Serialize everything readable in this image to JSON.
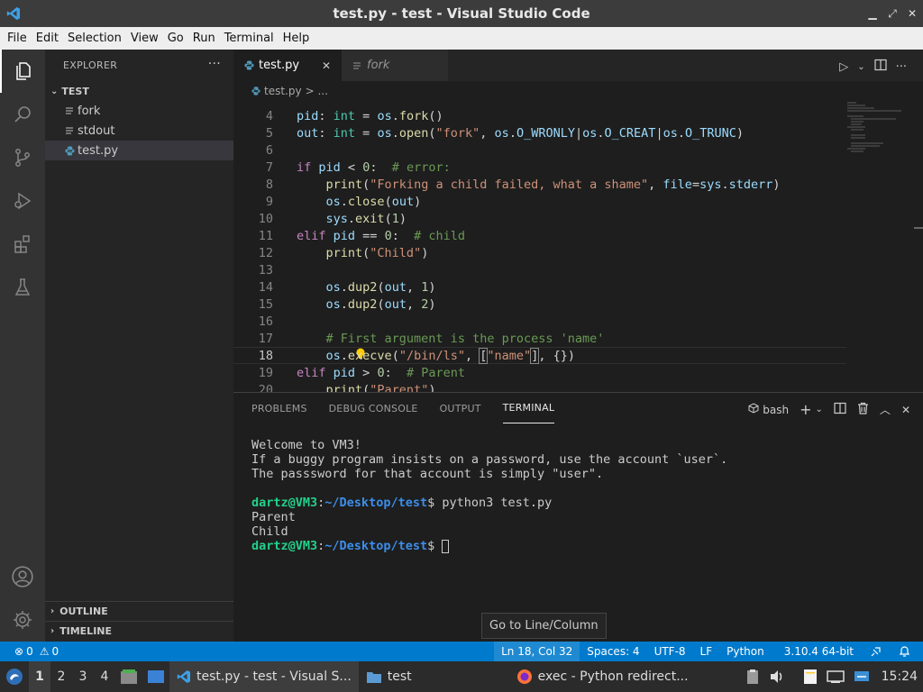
{
  "window": {
    "title": "test.py - test - Visual Studio Code",
    "minimize": "▁",
    "maximize": "⤢",
    "close": "✕"
  },
  "menu": [
    "File",
    "Edit",
    "Selection",
    "View",
    "Go",
    "Run",
    "Terminal",
    "Help"
  ],
  "activity_bar": [
    "explorer-icon",
    "search-icon",
    "source-control-icon",
    "run-debug-icon",
    "extensions-icon",
    "testing-icon",
    "account-icon",
    "manage-gear-icon"
  ],
  "sidebar": {
    "title": "EXPLORER",
    "more": "···",
    "folder": "TEST",
    "files": [
      {
        "name": "fork",
        "icon": "lines-file-icon"
      },
      {
        "name": "stdout",
        "icon": "lines-file-icon"
      },
      {
        "name": "test.py",
        "icon": "python-file-icon"
      }
    ],
    "outline": "OUTLINE",
    "timeline": "TIMELINE"
  },
  "tabs": [
    {
      "label": "test.py",
      "close": "✕"
    },
    {
      "label": "fork"
    }
  ],
  "breadcrumb": {
    "file": "test.py",
    "rest": "> ..."
  },
  "code": {
    "lines": [
      {
        "n": "4"
      },
      {
        "n": "5"
      },
      {
        "n": "6"
      },
      {
        "n": "7"
      },
      {
        "n": "8"
      },
      {
        "n": "9"
      },
      {
        "n": "10"
      },
      {
        "n": "11"
      },
      {
        "n": "12"
      },
      {
        "n": "13"
      },
      {
        "n": "14"
      },
      {
        "n": "15"
      },
      {
        "n": "16"
      },
      {
        "n": "17"
      },
      {
        "n": "18"
      },
      {
        "n": "19"
      },
      {
        "n": "20"
      }
    ]
  },
  "panel": {
    "tabs": [
      "PROBLEMS",
      "DEBUG CONSOLE",
      "OUTPUT",
      "TERMINAL"
    ],
    "shell": "bash",
    "terminal": {
      "lines": [
        "Welcome to VM3!",
        "If a buggy program insists on a password, use the account `user`.",
        "The passsword for that account is simply \"user\"."
      ],
      "user": "dartz@VM3",
      "path": "~/Desktop/test",
      "command": "python3 test.py",
      "output": [
        "Parent",
        "Child"
      ]
    }
  },
  "tooltip": "Go to Line/Column",
  "statusbar": {
    "errors": "0",
    "warnings": "0",
    "position": "Ln 18, Col 32",
    "spaces": "Spaces: 4",
    "encoding": "UTF-8",
    "eol": "LF",
    "language": "Python",
    "interpreter": "3.10.4 64-bit"
  },
  "taskbar": {
    "workspaces": [
      "1",
      "2",
      "3",
      "4"
    ],
    "apps": [
      {
        "label": "test.py - test - Visual S..."
      },
      {
        "label": "test"
      },
      {
        "label": "exec - Python redirect..."
      }
    ],
    "clock": "15:24"
  }
}
